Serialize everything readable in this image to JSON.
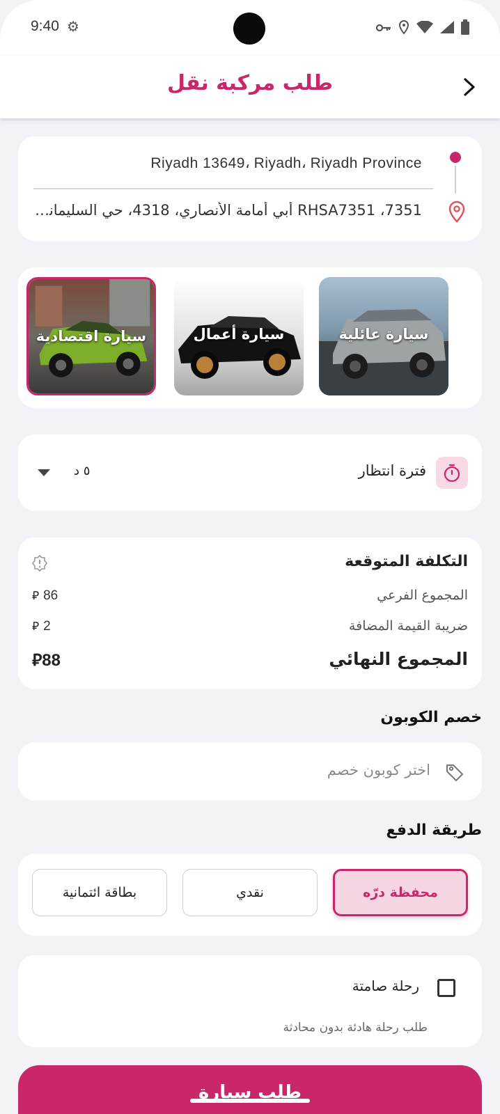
{
  "status_bar": {
    "time": "9:40"
  },
  "header": {
    "title": "طلب مركبة نقل",
    "back_icon": "chevron-right-icon"
  },
  "address": {
    "from": "Riyadh 13649، Riyadh، Riyadh Province",
    "to": "7351، RHSA7351 أبي أمامة الأنصاري، 4318، حي السليمانية،..."
  },
  "vehicles": [
    {
      "label": "سيارة عائلية",
      "selected": false
    },
    {
      "label": "سيارة أعمال",
      "selected": false
    },
    {
      "label": "سيارة اقتصادية",
      "selected": true
    }
  ],
  "waiting": {
    "label": "فترة انتظار",
    "value": "٥ د"
  },
  "cost": {
    "title": "التكلفة المتوقعة",
    "subtotal_label": "المجموع الفرعي",
    "subtotal_value": "86",
    "vat_label": "ضريبة القيمة المضافة",
    "vat_value": "2",
    "total_label": "المجموع النهائي",
    "total_value": "88",
    "currency": "⃁"
  },
  "coupon": {
    "title": "خصم الكوبون",
    "placeholder": "اختر كوبون خصم"
  },
  "payment": {
    "title": "طريقة الدفع",
    "options": [
      "محفظة درّه",
      "نقدي",
      "بطاقة ائتمانية"
    ],
    "selected": "محفظة درّه"
  },
  "silent_ride": {
    "label": "رحلة صامتة",
    "description": "طلب رحلة هادئة بدون محادثة",
    "checked": false
  },
  "submit": {
    "label": "طلب سيارة"
  },
  "colors": {
    "accent": "#c8276a",
    "accent_light": "#f6d6e3",
    "background": "#f3f3f7"
  }
}
